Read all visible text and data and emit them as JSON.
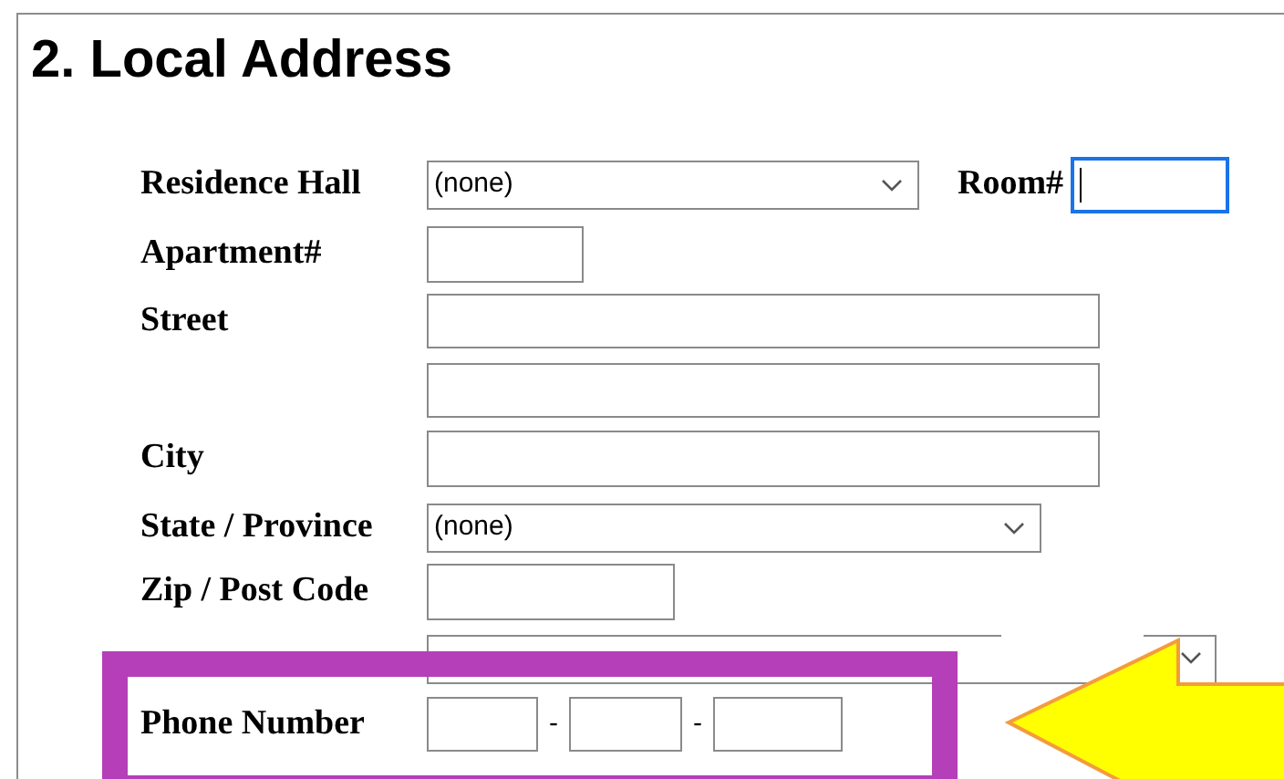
{
  "heading": "2. Local Address",
  "rows": [
    {
      "kind": "select",
      "label": "Residence Hall",
      "value": "(none)",
      "extra": {
        "label": "Room#",
        "focused": true
      }
    },
    {
      "kind": "text",
      "label": "Apartment#"
    },
    {
      "kind": "text",
      "label": "Street"
    },
    {
      "kind": "text"
    },
    {
      "kind": "text",
      "label": "City"
    },
    {
      "kind": "select",
      "label": "State / Province",
      "value": "(none)"
    },
    {
      "kind": "text",
      "label": "Zip / Post Code"
    },
    {
      "kind": "select"
    },
    {
      "kind": "phone",
      "label": "Phone Number",
      "separators": [
        "-",
        "-"
      ],
      "highlighted": true
    }
  ]
}
